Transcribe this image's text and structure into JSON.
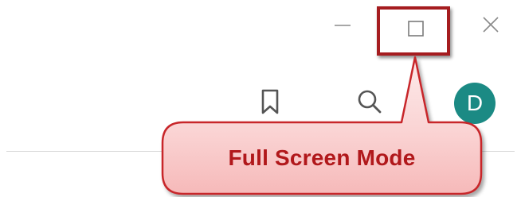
{
  "window_controls": {
    "minimize_icon": "minimize-icon",
    "maximize_icon": "maximize-icon",
    "close_icon": "close-icon"
  },
  "toolbar": {
    "bookmark_icon": "bookmark-icon",
    "search_icon": "search-icon",
    "avatar_initial": "D",
    "avatar_color": "#1b8a84"
  },
  "callout": {
    "text": "Full Screen Mode",
    "text_color": "#b1181b",
    "border_color": "#a51c1f",
    "fill_color": "#fbd8d8"
  }
}
